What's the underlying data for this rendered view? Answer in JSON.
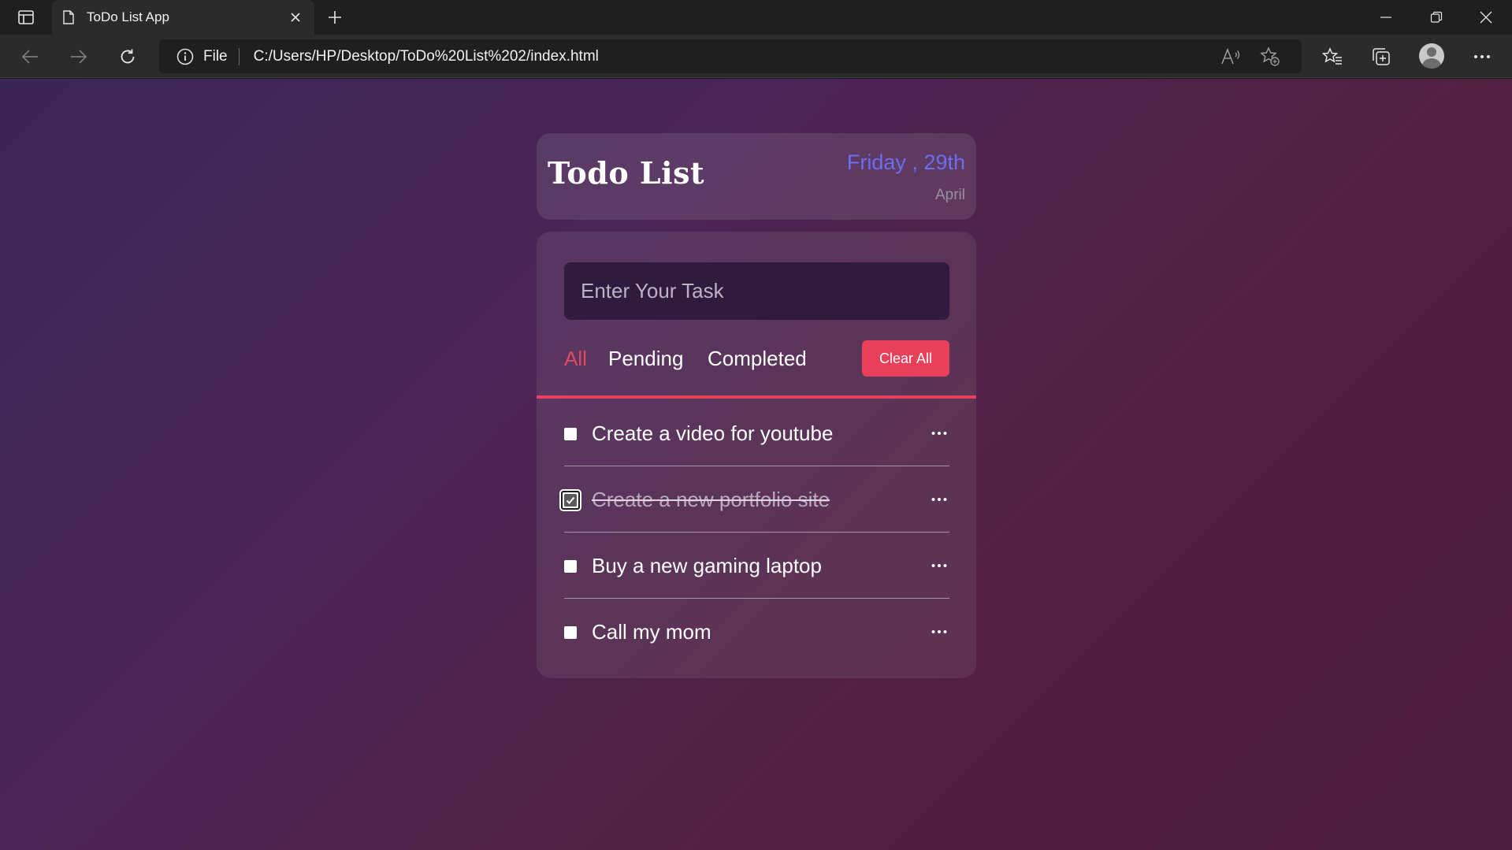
{
  "browser": {
    "tab_title": "ToDo List App",
    "scheme_label": "File",
    "url": "C:/Users/HP/Desktop/ToDo%20List%202/index.html"
  },
  "header": {
    "title": "Todo List",
    "day": "Friday , 29th",
    "month": "April"
  },
  "input": {
    "placeholder": "Enter Your Task",
    "value": ""
  },
  "filters": {
    "all": "All",
    "pending": "Pending",
    "completed": "Completed",
    "active": "all"
  },
  "clear_all_label": "Clear All",
  "tasks": [
    {
      "text": "Create a video for youtube",
      "completed": false
    },
    {
      "text": "Create a new portfolio site",
      "completed": true
    },
    {
      "text": "Buy a new gaming laptop",
      "completed": false
    },
    {
      "text": "Call my mom",
      "completed": false
    }
  ],
  "colors": {
    "accent": "#e83f5b",
    "date": "#6b6ef0"
  }
}
